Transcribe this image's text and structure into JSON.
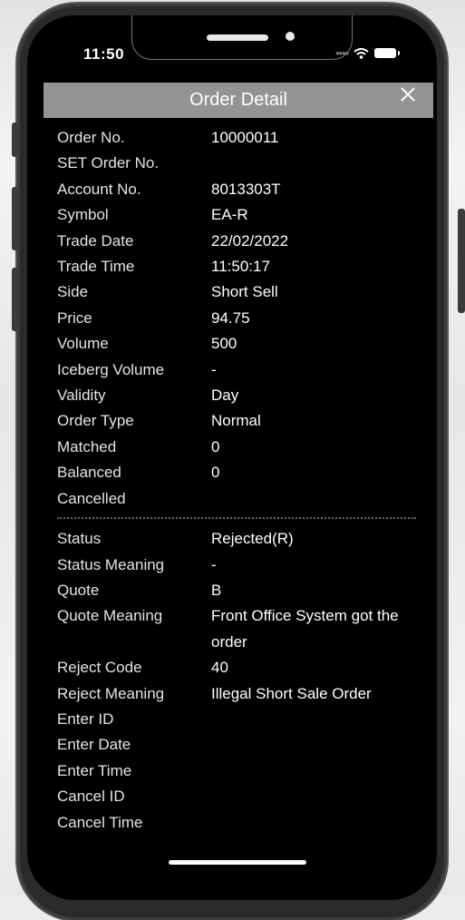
{
  "status_bar": {
    "time": "11:50"
  },
  "modal": {
    "title": "Order Detail"
  },
  "details_top": [
    {
      "label": "Order No.",
      "value": "10000011"
    },
    {
      "label": "SET Order No.",
      "value": ""
    },
    {
      "label": "Account No.",
      "value": "8013303T"
    },
    {
      "label": "Symbol",
      "value": "EA-R"
    },
    {
      "label": "Trade Date",
      "value": "22/02/2022"
    },
    {
      "label": "Trade Time",
      "value": "11:50:17"
    },
    {
      "label": "Side",
      "value": "Short Sell"
    },
    {
      "label": "Price",
      "value": "94.75"
    },
    {
      "label": "Volume",
      "value": "500"
    },
    {
      "label": "Iceberg Volume",
      "value": "-"
    },
    {
      "label": "Validity",
      "value": "Day"
    },
    {
      "label": "Order Type",
      "value": "Normal"
    },
    {
      "label": "Matched",
      "value": "0"
    },
    {
      "label": "Balanced",
      "value": "0"
    },
    {
      "label": "Cancelled",
      "value": ""
    }
  ],
  "details_bottom": [
    {
      "label": "Status",
      "value": "Rejected(R)"
    },
    {
      "label": "Status Meaning",
      "value": "-"
    },
    {
      "label": "Quote",
      "value": "B"
    },
    {
      "label": "Quote Meaning",
      "value": "Front Office System got the order"
    },
    {
      "label": "Reject Code",
      "value": "40"
    },
    {
      "label": "Reject Meaning",
      "value": "Illegal Short Sale Order"
    },
    {
      "label": "Enter ID",
      "value": ""
    },
    {
      "label": "Enter Date",
      "value": ""
    },
    {
      "label": "Enter Time",
      "value": ""
    },
    {
      "label": "Cancel ID",
      "value": ""
    },
    {
      "label": "Cancel Time",
      "value": ""
    }
  ],
  "icons": {
    "close": "close-icon",
    "wifi": "wifi-icon",
    "battery": "battery-icon"
  },
  "colors": {
    "screen_background": "#000000",
    "title_bar": "#939393",
    "text": "#ffffff"
  }
}
